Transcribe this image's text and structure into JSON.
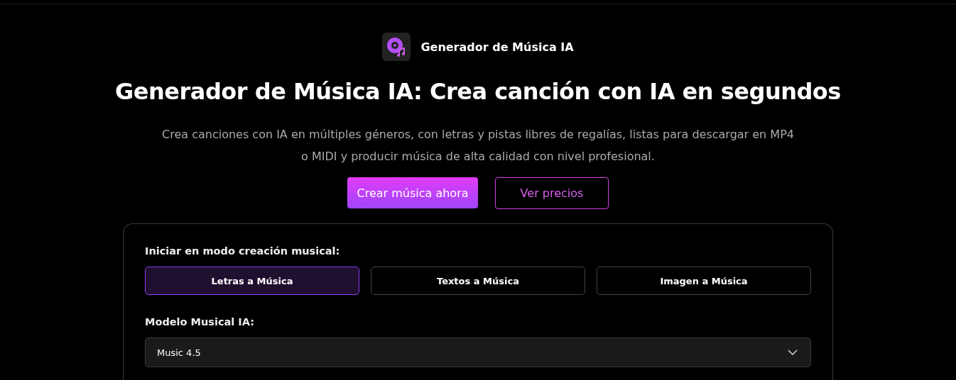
{
  "brand": {
    "name": "Generador de Música IA"
  },
  "hero": {
    "title": "Generador de Música IA: Crea canción con IA en segundos",
    "subtitle": "Crea canciones con IA en múltiples géneros, con letras y pistas libres de regalías, listas para descargar en MP4 o MIDI y producir música de alta calidad con nivel profesional."
  },
  "buttons": [
    {
      "label": "Crear música ahora",
      "kind": "primary"
    },
    {
      "label": "Ver precios",
      "kind": "outline"
    }
  ],
  "panel": {
    "mode_label": "Iniciar en modo creación musical:",
    "modes": [
      {
        "label": "Letras a Música",
        "selected": true
      },
      {
        "label": "Textos a Música",
        "selected": false
      },
      {
        "label": "Imagen a Música",
        "selected": false
      }
    ],
    "model_label": "Modelo Musical IA:",
    "model_select": {
      "value": "Music 4.5"
    }
  }
}
